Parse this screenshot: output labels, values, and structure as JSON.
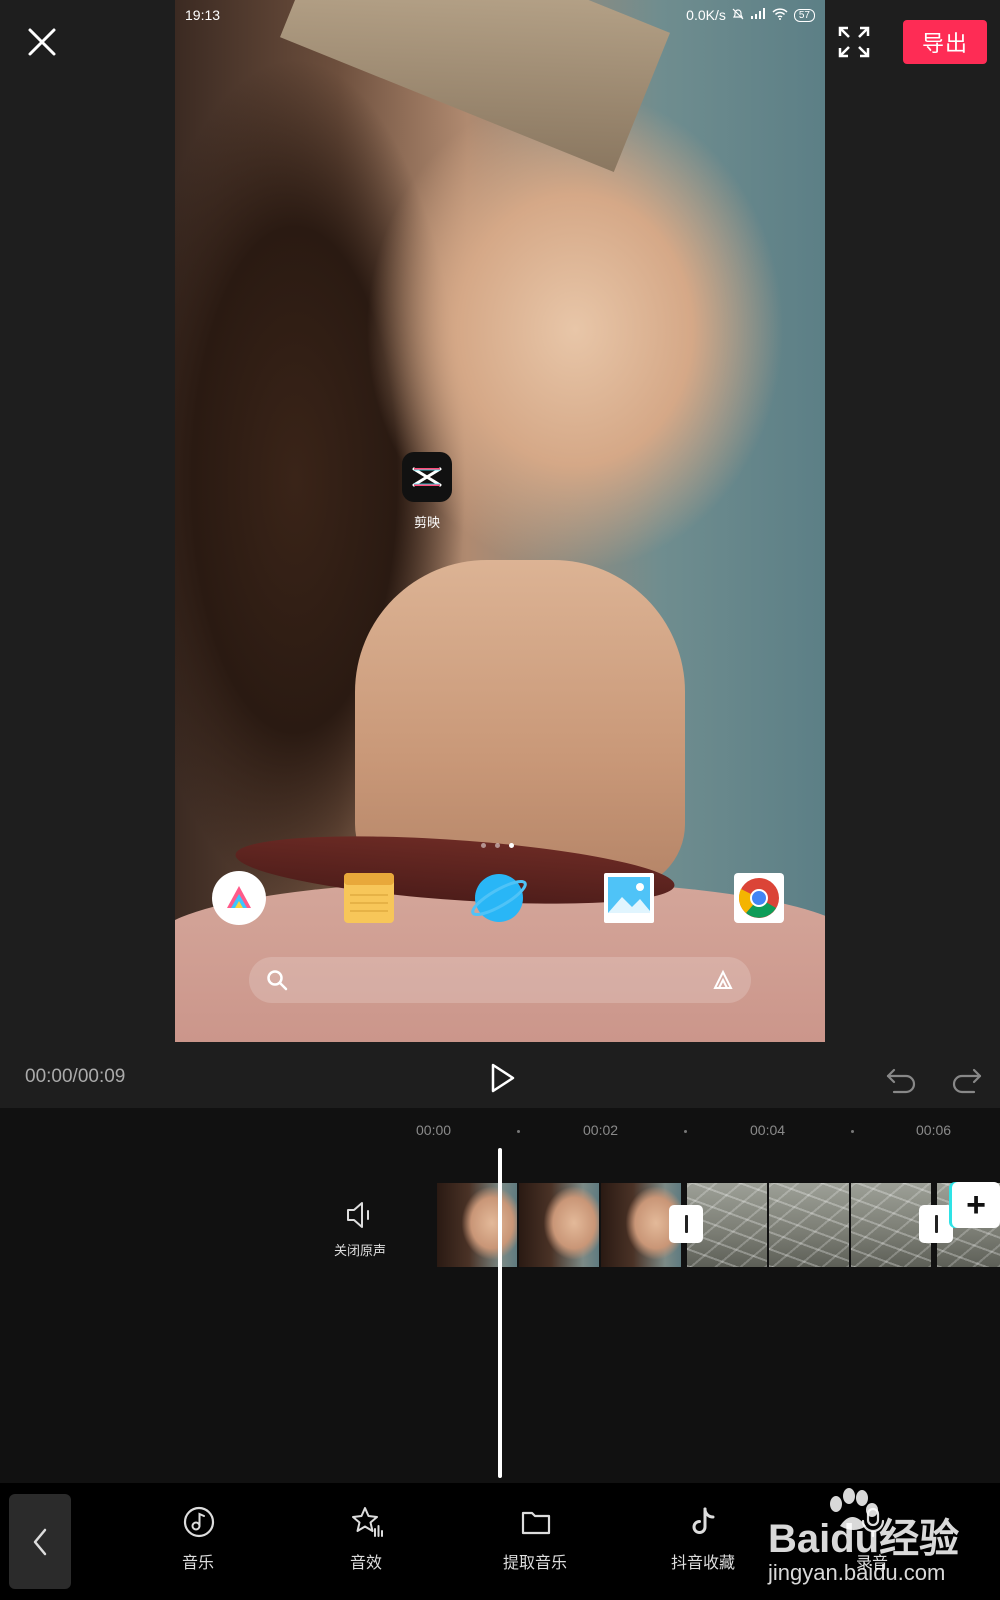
{
  "topbar": {
    "export_label": "导出"
  },
  "preview": {
    "status_time": "19:13",
    "status_speed": "0.0K/s",
    "battery": "57",
    "app_label": "剪映"
  },
  "playback": {
    "time_readout": "00:00/00:09"
  },
  "timeline": {
    "ticks": [
      "00:00",
      "00:02",
      "00:04",
      "00:06"
    ],
    "mute_label": "关闭原声"
  },
  "toolbar": {
    "items": [
      {
        "label": "音乐",
        "icon": "music-note-icon"
      },
      {
        "label": "音效",
        "icon": "sound-effect-star-icon"
      },
      {
        "label": "提取音乐",
        "icon": "folder-icon"
      },
      {
        "label": "抖音收藏",
        "icon": "douyin-icon"
      },
      {
        "label": "录音",
        "icon": "microphone-icon"
      }
    ]
  },
  "watermark": {
    "logo": "Baidu经验",
    "url": "jingyan.baidu.com"
  },
  "colors": {
    "accent": "#fe2c55",
    "background": "#1e1e1e",
    "timeline_bg": "#111111",
    "toolbar_bg": "#000000"
  }
}
